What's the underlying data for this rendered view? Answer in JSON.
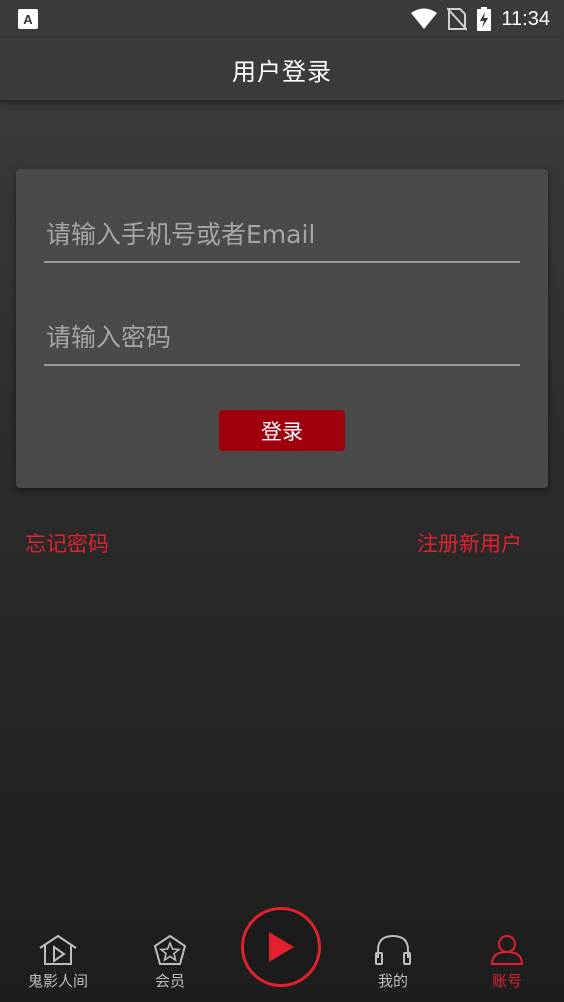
{
  "status_bar": {
    "left_icon": "a-notification-icon",
    "time": "11:34",
    "icons": [
      "wifi-icon",
      "no-sim-icon",
      "battery-charging-icon"
    ]
  },
  "header": {
    "title": "用户登录"
  },
  "login_form": {
    "phone_placeholder": "请输入手机号或者Email",
    "password_placeholder": "请输入密码",
    "login_button": "登录"
  },
  "links": {
    "forgot_password": "忘记密码",
    "register": "注册新用户"
  },
  "bottom_nav": {
    "items": [
      {
        "label": "鬼影人间",
        "icon": "home-play-icon"
      },
      {
        "label": "会员",
        "icon": "pentagon-star-icon"
      },
      {
        "label": "我的",
        "icon": "headphones-icon"
      },
      {
        "label": "账号",
        "icon": "user-icon",
        "active": true
      }
    ],
    "center": {
      "icon": "play-icon"
    }
  },
  "colors": {
    "accent": "#e4202e",
    "button": "#a0000c",
    "card": "#4a4a4a",
    "appbar": "#3b3b3b"
  }
}
